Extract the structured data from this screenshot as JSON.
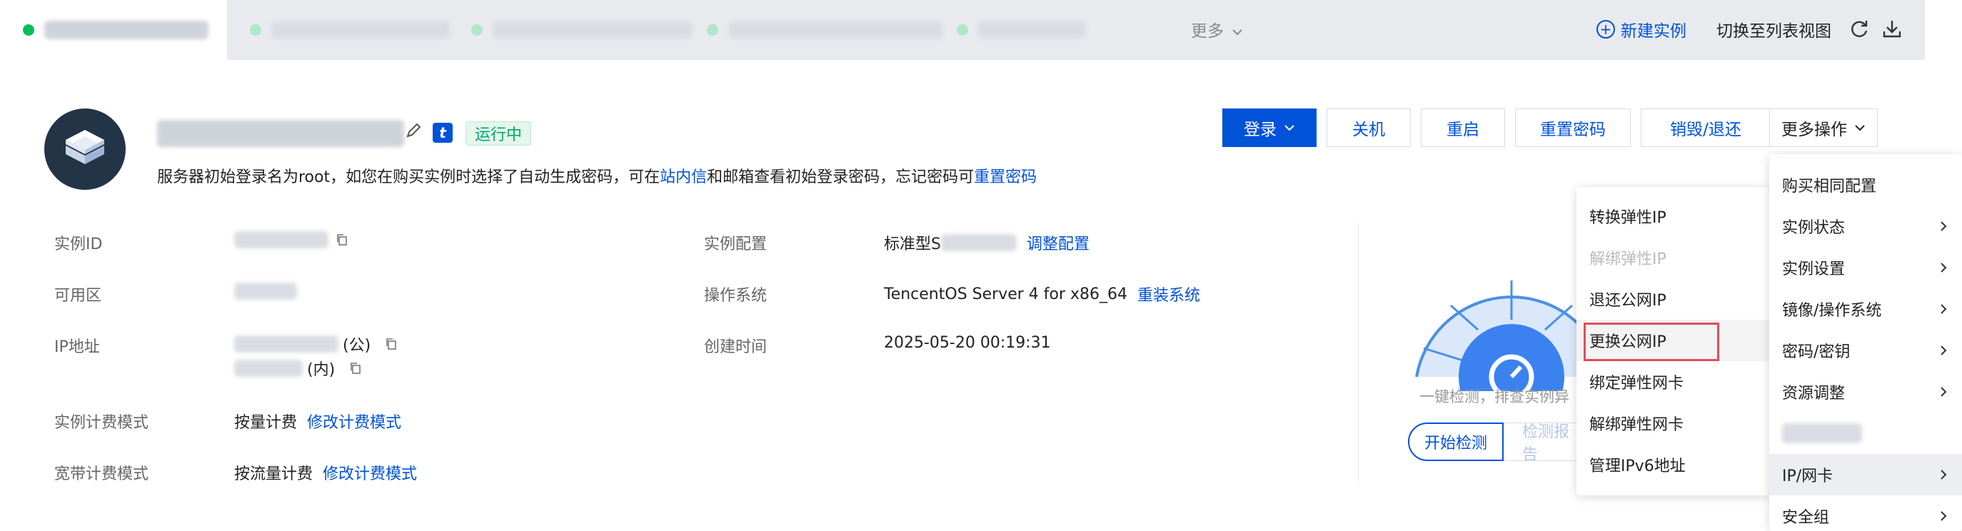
{
  "tabbar": {
    "more_label": "更多",
    "new_instance_label": "新建实例",
    "switch_view_label": "切换至列表视图"
  },
  "header": {
    "status": "运行中",
    "description_prefix": "服务器初始登录名为root，如您在购买实例时选择了自动生成密码，可在",
    "inbox_link": "站内信",
    "description_middle": "和邮箱查看初始登录密码，忘记密码可",
    "reset_link": "重置密码"
  },
  "actions": {
    "login": "登录",
    "shutdown": "关机",
    "restart": "重启",
    "reset_password": "重置密码",
    "destroy": "销毁/退还",
    "more": "更多操作"
  },
  "info": {
    "instance_id_label": "实例ID",
    "zone_label": "可用区",
    "ip_label": "IP地址",
    "ip_public_suffix": "(公)",
    "ip_private_suffix": "(内)",
    "billing_label": "实例计费模式",
    "billing_value": "按量计费",
    "billing_link": "修改计费模式",
    "bandwidth_label": "宽带计费模式",
    "bandwidth_value": "按流量计费",
    "bandwidth_link": "修改计费模式",
    "config_label": "实例配置",
    "config_value_prefix": "标准型S",
    "config_link": "调整配置",
    "os_label": "操作系统",
    "os_value": "TencentOS Server 4 for x86_64",
    "os_link": "重装系统",
    "created_label": "创建时间",
    "created_value": "2025-05-20 00:19:31"
  },
  "health": {
    "caption": "一键检测，排查实例异",
    "start_button": "开始检测",
    "report_button": "检测报告"
  },
  "submenu": [
    {
      "label": "转换弹性IP",
      "disabled": false
    },
    {
      "label": "解绑弹性IP",
      "disabled": true
    },
    {
      "label": "退还公网IP",
      "disabled": false
    },
    {
      "label": "更换公网IP",
      "disabled": false
    },
    {
      "label": "绑定弹性网卡",
      "disabled": false
    },
    {
      "label": "解绑弹性网卡",
      "disabled": false
    },
    {
      "label": "管理IPv6地址",
      "disabled": false
    }
  ],
  "mainmenu": [
    {
      "label": "购买相同配置"
    },
    {
      "label": "实例状态"
    },
    {
      "label": "实例设置"
    },
    {
      "label": "镜像/操作系统"
    },
    {
      "label": "密码/密钥"
    },
    {
      "label": "资源调整"
    },
    {
      "label": "IP/网卡"
    },
    {
      "label": "安全组"
    }
  ],
  "colors": {
    "brand": "#0052d9",
    "running_green": "#00a870",
    "highlight_red": "#e34d59"
  }
}
